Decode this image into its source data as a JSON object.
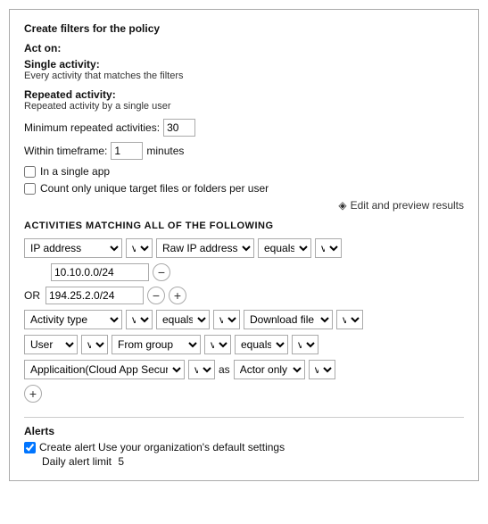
{
  "header": {
    "title": "Create filters for the policy"
  },
  "act_on": {
    "label": "Act on:",
    "single_activity": {
      "name": "Single activity:",
      "desc": "Every activity that matches the filters"
    },
    "repeated_activity": {
      "name": "Repeated activity:",
      "desc": "Repeated activity by a single user"
    },
    "min_repeated_label": "Minimum repeated activities:",
    "min_repeated_value": "30",
    "within_timeframe_label": "Within timeframe:",
    "within_timeframe_value": "1",
    "timeframe_unit": "minutes",
    "single_app_label": "In a single app",
    "unique_files_label": "Count only unique target files or folders per user"
  },
  "preview": {
    "icon": "◈",
    "label": "Edit and preview results"
  },
  "activities_section": {
    "header": "ACTIVITIES MATCHING ALL OF THE FOLLOWING"
  },
  "filters": [
    {
      "id": "row1",
      "fields": [
        {
          "type": "select",
          "value": "IP address",
          "size": "md"
        },
        {
          "type": "select",
          "value": "v",
          "size": "sm"
        },
        {
          "type": "select",
          "value": "Raw IP address",
          "size": "md"
        },
        {
          "type": "select",
          "value": "equals",
          "size": "sm"
        },
        {
          "type": "select",
          "value": "v",
          "size": "xs"
        }
      ]
    },
    {
      "id": "row2",
      "fields": [
        {
          "type": "text",
          "value": "10.10.0.0/24",
          "size": "md"
        },
        {
          "type": "circle-minus",
          "value": "−"
        }
      ]
    },
    {
      "id": "row3",
      "or": true,
      "fields": [
        {
          "type": "text",
          "value": "194.25.2.0/24",
          "size": "md"
        },
        {
          "type": "circle-minus",
          "value": "−"
        },
        {
          "type": "circle-plus",
          "value": "+"
        }
      ]
    },
    {
      "id": "row4",
      "fields": [
        {
          "type": "select",
          "value": "Activity type",
          "size": "md"
        },
        {
          "type": "select",
          "value": "v",
          "size": "xs"
        },
        {
          "type": "select",
          "value": "equals",
          "size": "sm"
        },
        {
          "type": "select",
          "value": "v",
          "size": "xs"
        },
        {
          "type": "select",
          "value": "Download file",
          "size": "md"
        },
        {
          "type": "select",
          "value": "v",
          "size": "xs"
        }
      ]
    },
    {
      "id": "row5",
      "fields": [
        {
          "type": "select",
          "value": "User",
          "size": "sm"
        },
        {
          "type": "select",
          "value": "v",
          "size": "xs"
        },
        {
          "type": "select",
          "value": "From group",
          "size": "md"
        },
        {
          "type": "select",
          "value": "v",
          "size": "xs"
        },
        {
          "type": "select",
          "value": "equals",
          "size": "sm"
        },
        {
          "type": "select",
          "value": "v",
          "size": "xs"
        }
      ]
    },
    {
      "id": "row6",
      "fields": [
        {
          "type": "select",
          "value": "Applicaition(Cloud App Security)",
          "size": "xl"
        },
        {
          "type": "select",
          "value": "v",
          "size": "xs"
        },
        {
          "type": "as-label",
          "value": "as"
        },
        {
          "type": "select",
          "value": "Actor only",
          "size": "md"
        },
        {
          "type": "select",
          "value": "v",
          "size": "xs"
        }
      ]
    }
  ],
  "add_button": "+",
  "alerts": {
    "title": "Alerts",
    "checkbox_checked": true,
    "create_alert_text": "Create alert Use your organization's default settings",
    "daily_limit_label": "Daily alert limit",
    "daily_limit_value": "5"
  }
}
